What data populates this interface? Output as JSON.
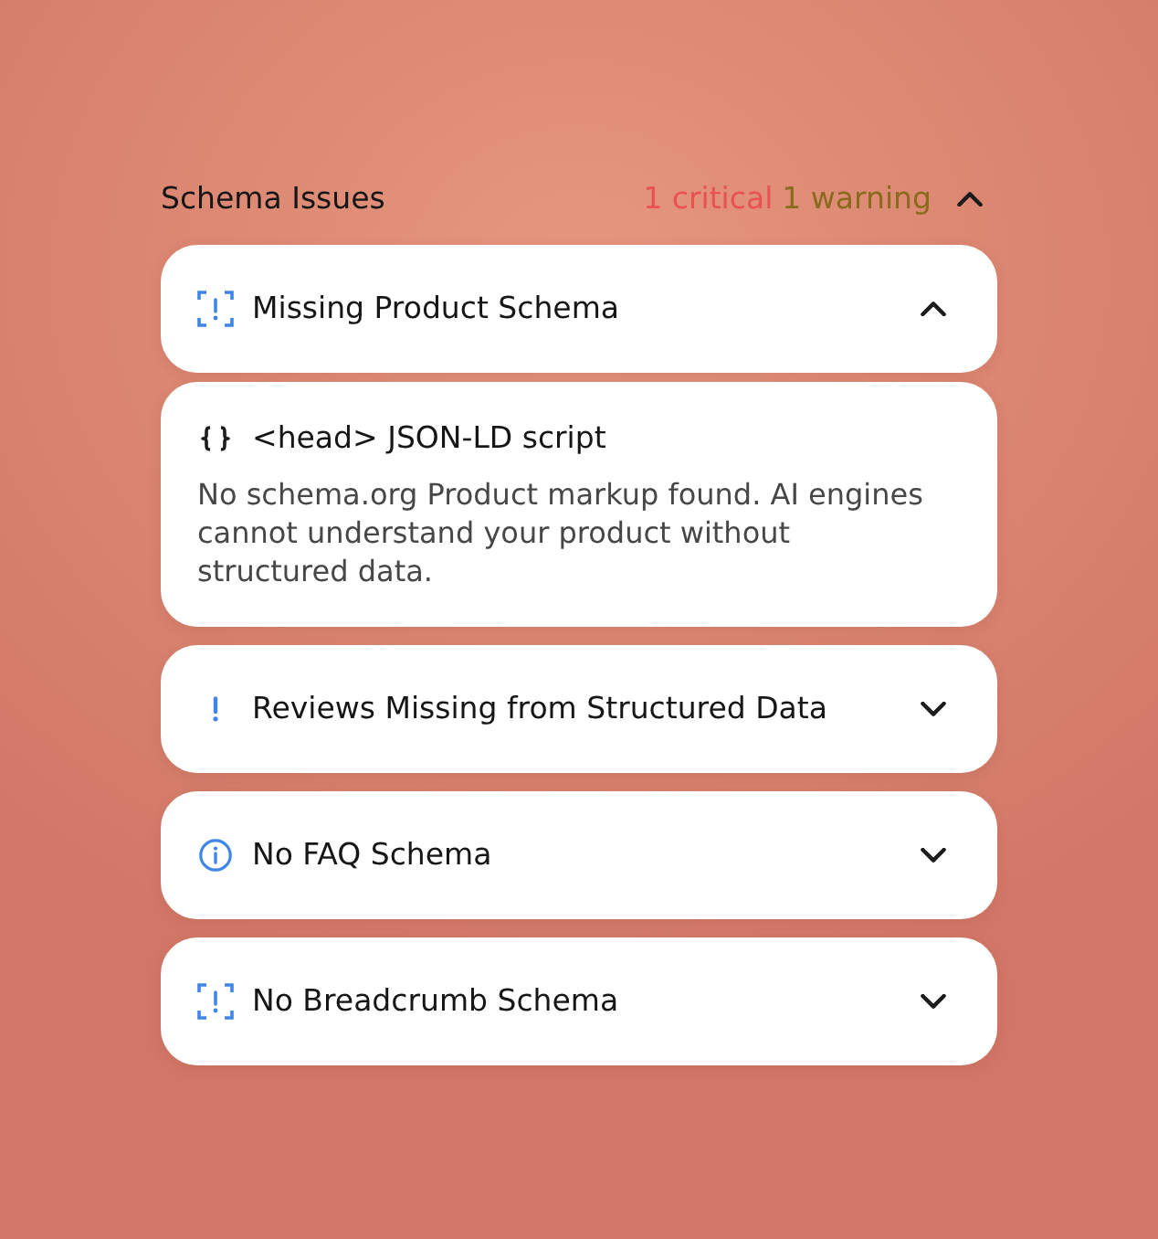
{
  "panel": {
    "title": "Schema Issues",
    "expanded": true,
    "counts": [
      {
        "text": "1 critical",
        "color": "#e8524f"
      },
      {
        "text": "1 warning",
        "color": "#8a6a1c"
      }
    ]
  },
  "issues": [
    {
      "kind": "scan",
      "title": "Missing Product Schema",
      "expanded": true,
      "detail": {
        "location": "<head> JSON-LD script",
        "description": "No schema.org Product markup found. AI engines cannot understand your product without structured data."
      }
    },
    {
      "kind": "alert",
      "title": "Reviews Missing from Structured Data",
      "expanded": false
    },
    {
      "kind": "info",
      "title": "No FAQ Schema",
      "expanded": false
    },
    {
      "kind": "scan",
      "title": "No Breadcrumb Schema",
      "expanded": false
    }
  ]
}
